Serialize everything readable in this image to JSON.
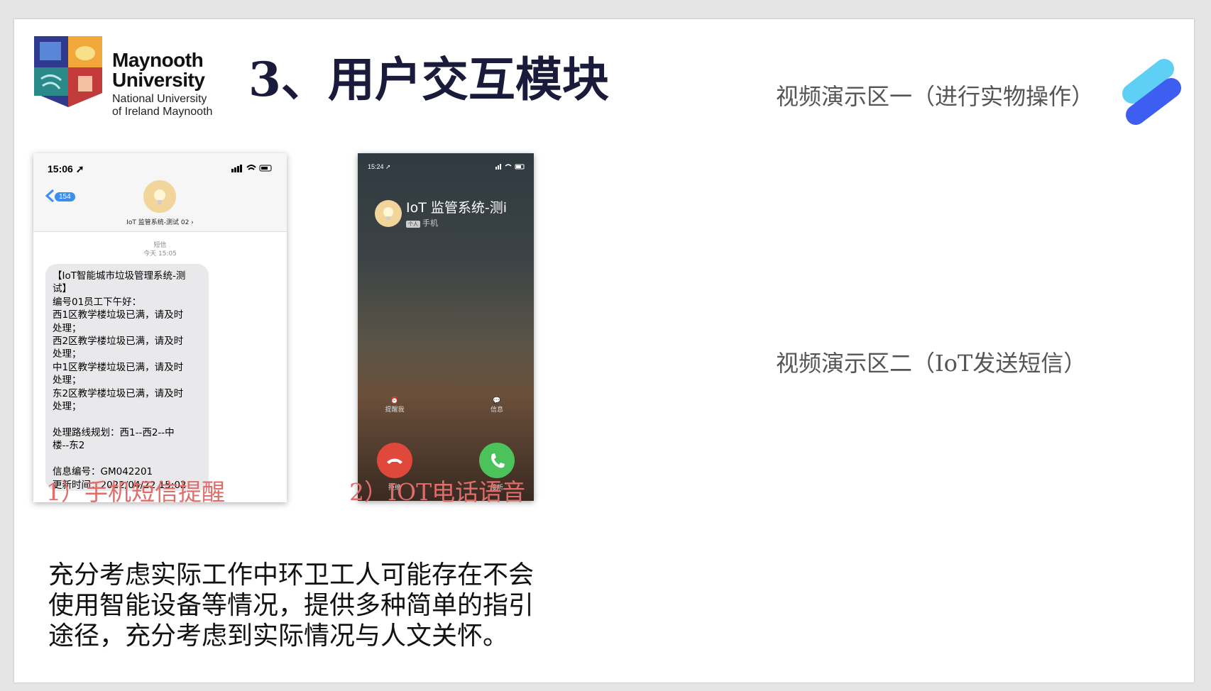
{
  "logo": {
    "name_line1": "Maynooth",
    "name_line2": "University",
    "sub_line1": "National University",
    "sub_line2": "of Ireland Maynooth"
  },
  "title": "3、用户交互模块",
  "video_labels": {
    "one": "视频演示区一（进行实物操作）",
    "two": "视频演示区二（IoT发送短信）"
  },
  "phone_sms": {
    "time": "15:06",
    "badge": "154",
    "contact": "IoT 监管系统-测试 02 ›",
    "meta_line1": "短信",
    "meta_line2": "今天 15:05",
    "message_lines": [
      "【IoT智能城市垃圾管理系统-测",
      "试】",
      "编号01员工下午好：",
      "西1区教学楼垃圾已满，请及时",
      "处理；",
      "西2区教学楼垃圾已满，请及时",
      "处理；",
      "中1区教学楼垃圾已满，请及时",
      "处理；",
      "东2区教学楼垃圾已满，请及时",
      "处理；",
      "",
      "处理路线规划：西1--西2--中",
      "楼--东2",
      "",
      "信息编号：GM042201",
      "更新时间：2022/04/22 15:02"
    ]
  },
  "phone_call": {
    "time": "15:24",
    "caller": "IoT 监管系统-测i",
    "tag": "个人",
    "sub": "手机",
    "remind_label": "提醒我",
    "message_label": "信息",
    "decline_label": "拒绝",
    "accept_label": "接听",
    "decline_color": "#e0483c",
    "accept_color": "#4cc35a"
  },
  "captions": {
    "one": "1）手机短信提醒",
    "two": "2）IOT电话语音"
  },
  "paragraph_lines": [
    "充分考虑实际工作中环卫工人可能存在不会",
    "使用智能设备等情况，提供多种简单的指引",
    "途径，充分考虑到实际情况与人文关怀。"
  ],
  "colors": {
    "caption": "#e06d69",
    "title": "#1a1a3a",
    "deco_light": "#5fd0f5",
    "deco_dark": "#3d5ef0"
  }
}
